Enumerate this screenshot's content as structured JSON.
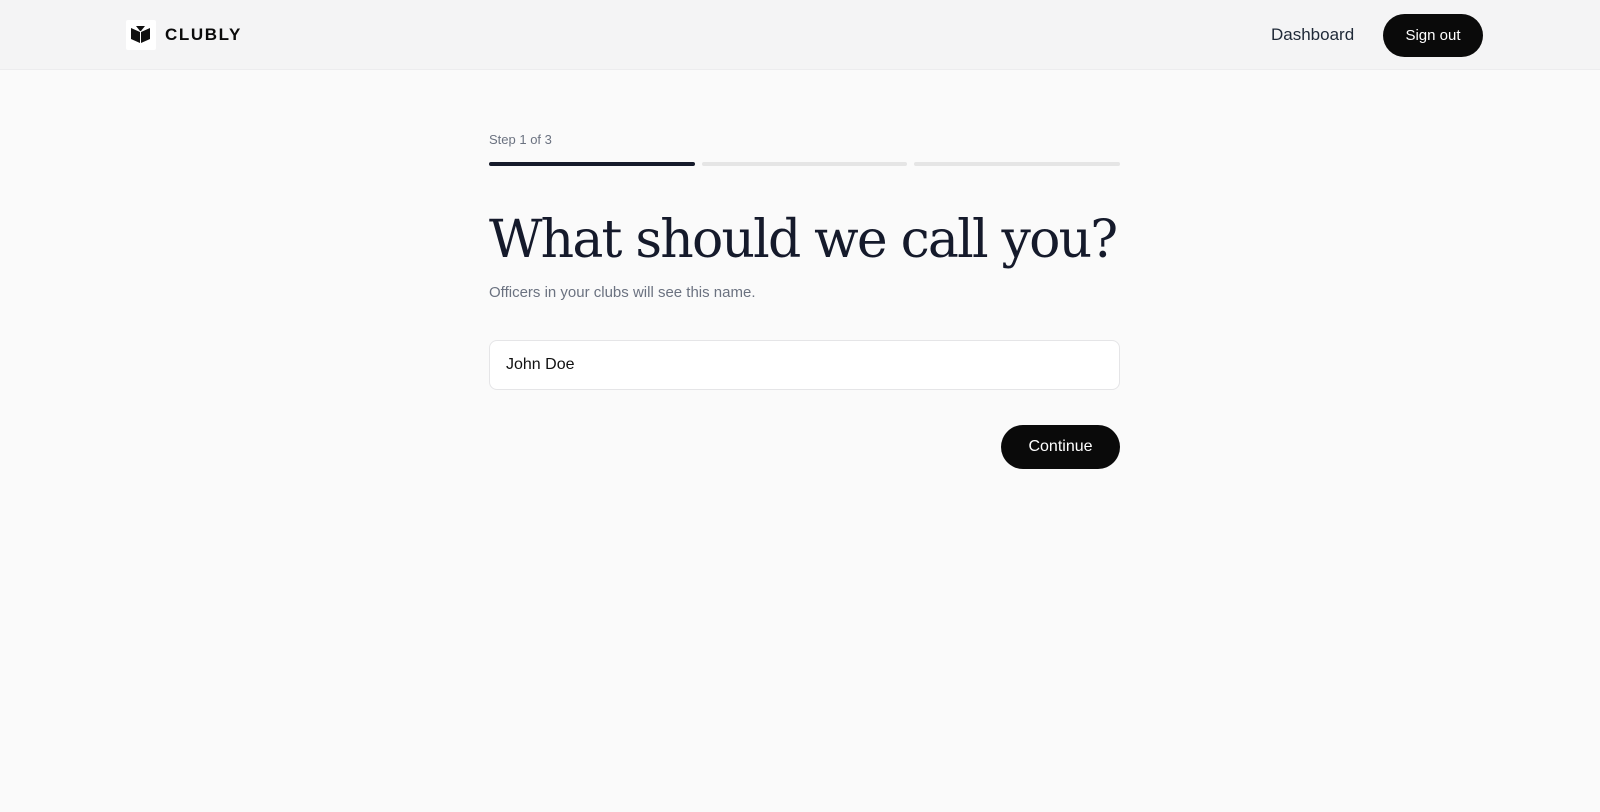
{
  "header": {
    "brand": {
      "name": "CLUBLY",
      "icon": "clubly-logo-icon"
    },
    "nav": {
      "dashboard_label": "Dashboard",
      "signout_label": "Sign out"
    }
  },
  "onboarding": {
    "step_label": "Step 1 of 3",
    "progress": {
      "current_step": 1,
      "total_steps": 3
    },
    "title": "What should we call you?",
    "subtitle": "Officers in your clubs will see this name.",
    "name_field": {
      "value": "John Doe",
      "placeholder": ""
    },
    "continue_label": "Continue"
  },
  "colors": {
    "page_background": "#fafafa",
    "header_background": "#f4f4f5",
    "primary_button": "#0a0a0a",
    "progress_active": "#161b2b",
    "progress_inactive": "#e5e5e5",
    "muted_text": "#6b7280"
  }
}
